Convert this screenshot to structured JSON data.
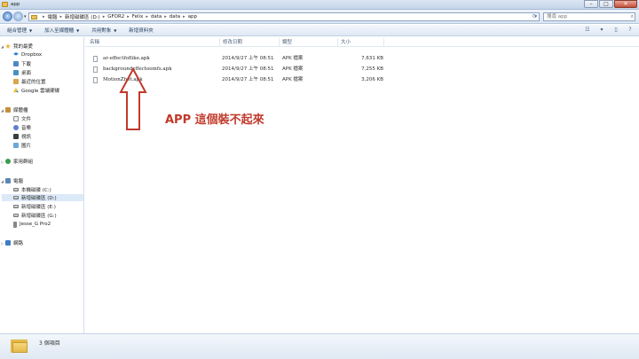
{
  "window": {
    "title": "app",
    "min_label": "–",
    "max_label": "□",
    "close_label": "✕"
  },
  "address": {
    "crumbs": [
      "電腦",
      "新增磁碟區 (D:)",
      "GFOR2",
      "Felix",
      "data",
      "data",
      "app"
    ],
    "dropdown": "▾",
    "refresh": "⟳",
    "search_placeholder": "搜尋 app"
  },
  "toolbar": {
    "items": [
      "組合管理",
      "加入至媒體櫃",
      "共用對象",
      "新增資料夾"
    ],
    "right_icons": [
      "☷",
      "▾",
      "▯",
      "?"
    ]
  },
  "nav": {
    "favorites": "我的最愛",
    "dropbox": "Dropbox",
    "downloads": "下載",
    "desktop": "桌面",
    "recent": "最近的位置",
    "gdrive": "Google 雲端硬碟",
    "libraries": "媒體櫃",
    "docs": "文件",
    "music": "音樂",
    "videos": "視訊",
    "pictures": "圖片",
    "homegroup": "家用群組",
    "computer": "電腦",
    "drive_c": "本機磁碟 (C:)",
    "drive_d": "新增磁碟區 (D:)",
    "drive_e": "新增磁碟區 (E:)",
    "drive_g": "新增磁碟區 (G:)",
    "phone": "Jesse_G Pro2",
    "network": "網路"
  },
  "columns": {
    "name": "名稱",
    "date": "修改日期",
    "type": "類型",
    "size": "大小"
  },
  "files": [
    {
      "name": "ar-effectfoflike.apk",
      "date": "2014/9/27 上午 08:51",
      "type": "APK 檔案",
      "size": "7,631 KB"
    },
    {
      "name": "backgroundeffectoomfs.apk",
      "date": "2014/9/27 上午 08:51",
      "type": "APK 檔案",
      "size": "7,255 KB"
    },
    {
      "name": "MotionZhot.apk",
      "date": "2014/9/27 上午 08:51",
      "type": "APK 檔案",
      "size": "3,206 KB"
    }
  ],
  "annotation": {
    "text": "APP 這個裝不起來",
    "color": "#c0392b"
  },
  "status": {
    "item_count": "3 個項目"
  }
}
